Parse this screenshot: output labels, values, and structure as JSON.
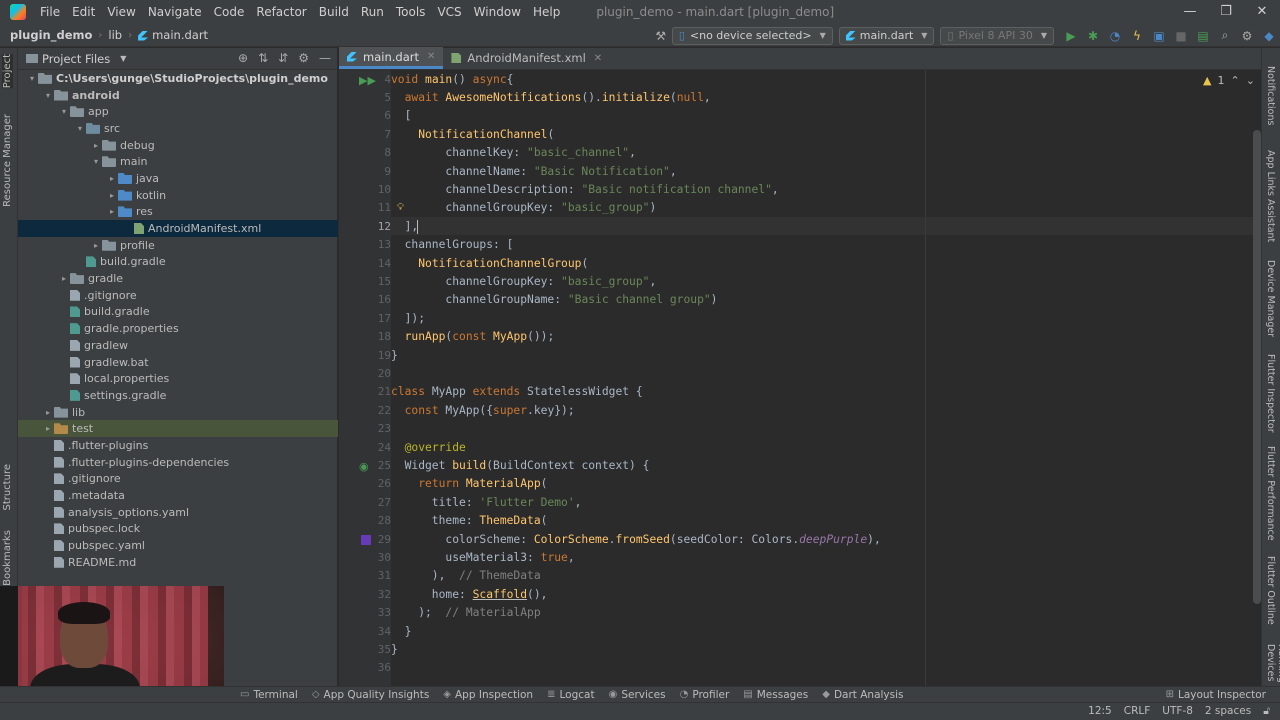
{
  "menubar": {
    "items": [
      "File",
      "Edit",
      "View",
      "Navigate",
      "Code",
      "Refactor",
      "Build",
      "Run",
      "Tools",
      "VCS",
      "Window",
      "Help"
    ],
    "window_title": "plugin_demo - main.dart [plugin_demo]",
    "controls": [
      "—",
      "❐",
      "✕"
    ]
  },
  "navbar": {
    "crumbs": [
      "plugin_demo",
      "lib",
      "main.dart"
    ],
    "device_combo": "<no device selected>",
    "config_combo": "main.dart",
    "emulator_combo": "Pixel 8 API 30"
  },
  "left_strip": {
    "project": "Project",
    "resource_manager": "Resource Manager",
    "structure": "Structure",
    "bookmarks": "Bookmarks"
  },
  "project_panel": {
    "title": "Project Files",
    "tree": [
      {
        "label": "C:\\Users\\gunge\\StudioProjects\\plugin_demo",
        "depth": 0,
        "arrow": "▾",
        "icon": "folder"
      },
      {
        "label": "android",
        "depth": 1,
        "arrow": "▾",
        "icon": "folder",
        "bold": true
      },
      {
        "label": "app",
        "depth": 2,
        "arrow": "▾",
        "icon": "folder"
      },
      {
        "label": "src",
        "depth": 3,
        "arrow": "▾",
        "icon": "folder src"
      },
      {
        "label": "debug",
        "depth": 4,
        "arrow": "▸",
        "icon": "folder"
      },
      {
        "label": "main",
        "depth": 4,
        "arrow": "▾",
        "icon": "folder"
      },
      {
        "label": "java",
        "depth": 5,
        "arrow": "▸",
        "icon": "folder blue"
      },
      {
        "label": "kotlin",
        "depth": 5,
        "arrow": "▸",
        "icon": "folder blue"
      },
      {
        "label": "res",
        "depth": 5,
        "arrow": "▸",
        "icon": "folder blue"
      },
      {
        "label": "AndroidManifest.xml",
        "depth": 6,
        "arrow": "",
        "icon": "file xml",
        "selected": true
      },
      {
        "label": "profile",
        "depth": 4,
        "arrow": "▸",
        "icon": "folder"
      },
      {
        "label": "build.gradle",
        "depth": 3,
        "arrow": "",
        "icon": "file gradle"
      },
      {
        "label": "gradle",
        "depth": 2,
        "arrow": "▸",
        "icon": "folder"
      },
      {
        "label": ".gitignore",
        "depth": 2,
        "arrow": "",
        "icon": "file"
      },
      {
        "label": "build.gradle",
        "depth": 2,
        "arrow": "",
        "icon": "file gradle"
      },
      {
        "label": "gradle.properties",
        "depth": 2,
        "arrow": "",
        "icon": "file gradle"
      },
      {
        "label": "gradlew",
        "depth": 2,
        "arrow": "",
        "icon": "file"
      },
      {
        "label": "gradlew.bat",
        "depth": 2,
        "arrow": "",
        "icon": "file"
      },
      {
        "label": "local.properties",
        "depth": 2,
        "arrow": "",
        "icon": "file"
      },
      {
        "label": "settings.gradle",
        "depth": 2,
        "arrow": "",
        "icon": "file gradle"
      },
      {
        "label": "lib",
        "depth": 1,
        "arrow": "▸",
        "icon": "folder"
      },
      {
        "label": "test",
        "depth": 1,
        "arrow": "▸",
        "icon": "folder orange",
        "hl": true
      },
      {
        "label": ".flutter-plugins",
        "depth": 1,
        "arrow": "",
        "icon": "file"
      },
      {
        "label": ".flutter-plugins-dependencies",
        "depth": 1,
        "arrow": "",
        "icon": "file"
      },
      {
        "label": ".gitignore",
        "depth": 1,
        "arrow": "",
        "icon": "file"
      },
      {
        "label": ".metadata",
        "depth": 1,
        "arrow": "",
        "icon": "file"
      },
      {
        "label": "analysis_options.yaml",
        "depth": 1,
        "arrow": "",
        "icon": "file"
      },
      {
        "label": "pubspec.lock",
        "depth": 1,
        "arrow": "",
        "icon": "file"
      },
      {
        "label": "pubspec.yaml",
        "depth": 1,
        "arrow": "",
        "icon": "file"
      },
      {
        "label": "README.md",
        "depth": 1,
        "arrow": "",
        "icon": "file"
      }
    ]
  },
  "tabs": [
    {
      "label": "main.dart",
      "icon": "dart",
      "active": true
    },
    {
      "label": "AndroidManifest.xml",
      "icon": "xml",
      "active": false
    }
  ],
  "editor": {
    "line_numbers": [
      "4",
      "5",
      "6",
      "7",
      "8",
      "9",
      "10",
      "11",
      "12",
      "13",
      "14",
      "15",
      "16",
      "17",
      "18",
      "19",
      "20",
      "21",
      "22",
      "23",
      "24",
      "25",
      "26",
      "27",
      "28",
      "29",
      "30",
      "31",
      "32",
      "33",
      "34",
      "35",
      "36"
    ],
    "current_line": "12",
    "inspection_count": "1",
    "lines": [
      [
        [
          "kw",
          "void "
        ],
        [
          "fn",
          "main"
        ],
        [
          "",
          "() "
        ],
        [
          "kw",
          "async"
        ],
        [
          "",
          "{"
        ]
      ],
      [
        [
          "",
          "  "
        ],
        [
          "kw",
          "await "
        ],
        [
          "cls",
          "AwesomeNotifications"
        ],
        [
          "",
          "()."
        ],
        [
          "fn",
          "initialize"
        ],
        [
          "",
          "("
        ],
        [
          "kw",
          "null"
        ],
        [
          "",
          ","
        ]
      ],
      [
        [
          "",
          "  ["
        ]
      ],
      [
        [
          "",
          "    "
        ],
        [
          "cls",
          "NotificationChannel"
        ],
        [
          "",
          "("
        ]
      ],
      [
        [
          "",
          "        channelKey: "
        ],
        [
          "str",
          "\"basic_channel\""
        ],
        [
          "",
          ","
        ]
      ],
      [
        [
          "",
          "        channelName: "
        ],
        [
          "str",
          "\"Basic Notification\""
        ],
        [
          "",
          ","
        ]
      ],
      [
        [
          "",
          "        channelDescription: "
        ],
        [
          "str",
          "\"Basic notification channel\""
        ],
        [
          "",
          ","
        ]
      ],
      [
        [
          "",
          "        channelGroupKey: "
        ],
        [
          "str",
          "\"basic_group\""
        ],
        [
          "",
          ")"
        ]
      ],
      [
        [
          "",
          "  ],"
        ]
      ],
      [
        [
          "",
          "  channelGroups: ["
        ]
      ],
      [
        [
          "",
          "    "
        ],
        [
          "cls",
          "NotificationChannelGroup"
        ],
        [
          "",
          "("
        ]
      ],
      [
        [
          "",
          "        channelGroupKey: "
        ],
        [
          "str",
          "\"basic_group\""
        ],
        [
          "",
          ","
        ]
      ],
      [
        [
          "",
          "        channelGroupName: "
        ],
        [
          "str",
          "\"Basic channel group\""
        ],
        [
          "",
          ")"
        ]
      ],
      [
        [
          "",
          "  ]);"
        ]
      ],
      [
        [
          "",
          "  "
        ],
        [
          "fn",
          "runApp"
        ],
        [
          "",
          "("
        ],
        [
          "kw",
          "const "
        ],
        [
          "cls",
          "MyApp"
        ],
        [
          "",
          "());"
        ]
      ],
      [
        [
          "",
          "}"
        ]
      ],
      [
        [
          "",
          ""
        ]
      ],
      [
        [
          "kw",
          "class "
        ],
        [
          "",
          "MyApp "
        ],
        [
          "kw",
          "extends "
        ],
        [
          "",
          "StatelessWidget {"
        ]
      ],
      [
        [
          "",
          "  "
        ],
        [
          "kw",
          "const "
        ],
        [
          "",
          "MyApp({"
        ],
        [
          "kw",
          "super"
        ],
        [
          "",
          ".key});"
        ]
      ],
      [
        [
          "",
          ""
        ]
      ],
      [
        [
          "",
          "  "
        ],
        [
          "ann",
          "@override"
        ]
      ],
      [
        [
          "",
          "  Widget "
        ],
        [
          "fn",
          "build"
        ],
        [
          "",
          "(BuildContext context) {"
        ]
      ],
      [
        [
          "",
          "    "
        ],
        [
          "kw",
          "return "
        ],
        [
          "cls",
          "MaterialApp"
        ],
        [
          "",
          "("
        ]
      ],
      [
        [
          "",
          "      title: "
        ],
        [
          "str",
          "'Flutter Demo'"
        ],
        [
          "",
          ","
        ]
      ],
      [
        [
          "",
          "      theme: "
        ],
        [
          "cls",
          "ThemeData"
        ],
        [
          "",
          "("
        ]
      ],
      [
        [
          "",
          "        colorScheme: "
        ],
        [
          "cls",
          "ColorScheme"
        ],
        [
          "",
          "."
        ],
        [
          "fn",
          "fromSeed"
        ],
        [
          "",
          "(seedColor: Colors."
        ],
        [
          "ital",
          "deepPurple"
        ],
        [
          "",
          "),"
        ]
      ],
      [
        [
          "",
          "        useMaterial3: "
        ],
        [
          "kw",
          "true"
        ],
        [
          "",
          ","
        ]
      ],
      [
        [
          "",
          "      ),  "
        ],
        [
          "cmt",
          "// ThemeData"
        ]
      ],
      [
        [
          "",
          "      home: "
        ],
        [
          "cls",
          "Scaffold"
        ],
        [
          "",
          "(),"
        ]
      ],
      [
        [
          "",
          "    );  "
        ],
        [
          "cmt",
          "// MaterialApp"
        ]
      ],
      [
        [
          "",
          "  }"
        ]
      ],
      [
        [
          "",
          "}"
        ]
      ],
      [
        [
          "",
          ""
        ]
      ]
    ]
  },
  "right_strip": [
    "Notifications",
    "App Links Assistant",
    "Device Manager",
    "Flutter Inspector",
    "Flutter Performance",
    "Flutter Outline",
    "Running Devices"
  ],
  "bottom_tools": [
    "Terminal",
    "App Quality Insights",
    "App Inspection",
    "Logcat",
    "Services",
    "Profiler",
    "Messages",
    "Dart Analysis"
  ],
  "layout_inspector": "Layout Inspector",
  "status": {
    "position": "12:5",
    "line_sep": "CRLF",
    "encoding": "UTF-8",
    "indent": "2 spaces"
  },
  "colors": {
    "keyword": "#cc7832",
    "string": "#6a8759",
    "function": "#ffc66d",
    "selection": "#0d293e",
    "accent": "#4a88c7",
    "swatch": "#673ab7"
  }
}
